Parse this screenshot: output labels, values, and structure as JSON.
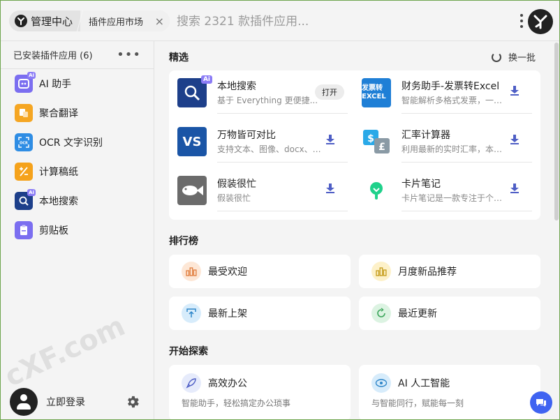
{
  "header": {
    "home_label": "管理中心",
    "current_tab": "插件应用市场",
    "close_symbol": "×",
    "search_placeholder": "搜索 2321 款插件应用..."
  },
  "sidebar": {
    "title": "已安装插件应用 (6)",
    "more": "•••",
    "items": [
      {
        "label": "AI 助手",
        "icon": "ai-assistant-icon",
        "color": "#7b6ef0"
      },
      {
        "label": "聚合翻译",
        "icon": "translate-icon",
        "color": "#f5a623"
      },
      {
        "label": "OCR 文字识别",
        "icon": "ocr-icon",
        "color": "#2f8de4"
      },
      {
        "label": "计算稿纸",
        "icon": "calculator-icon",
        "color": "#f5a21b"
      },
      {
        "label": "本地搜索",
        "icon": "local-search-icon",
        "color": "#1d3f8a"
      },
      {
        "label": "剪贴板",
        "icon": "clipboard-icon",
        "color": "#7b6ef0"
      }
    ],
    "login_label": "立即登录"
  },
  "featured": {
    "title": "精选",
    "refresh_label": "换一批",
    "plugins": [
      {
        "name": "本地搜索",
        "desc": "基于 Everything 更便捷...",
        "action": "打开",
        "icon": "local-search-icon"
      },
      {
        "name": "财务助手-发票转Excel",
        "desc": "智能解析多格式发票，一键...",
        "icon": "invoice-excel-icon",
        "icon_text": "发票转 EXCEL"
      },
      {
        "name": "万物皆可对比",
        "desc": "支持文本、图像、docx、e...",
        "icon": "compare-icon",
        "icon_text": "VS"
      },
      {
        "name": "汇率计算器",
        "desc": "利用最新的实时汇率，本换...",
        "icon": "exchange-rate-icon"
      },
      {
        "name": "假装很忙",
        "desc": "假装很忙",
        "icon": "fish-icon"
      },
      {
        "name": "卡片笔记",
        "desc": "卡片笔记是一款专注于个人...",
        "icon": "card-note-icon"
      }
    ]
  },
  "ranking": {
    "title": "排行榜",
    "items": [
      {
        "label": "最受欢迎",
        "icon": "bar-chart-icon",
        "bg": "#fde7d6"
      },
      {
        "label": "月度新品推荐",
        "icon": "bar-chart-icon",
        "bg": "#fdf1c9"
      },
      {
        "label": "最新上架",
        "icon": "upload-icon",
        "bg": "#d7ecfb"
      },
      {
        "label": "最近更新",
        "icon": "refresh-icon",
        "bg": "#dcf3e2"
      }
    ]
  },
  "explore": {
    "title": "开始探索",
    "items": [
      {
        "title": "高效办公",
        "desc": "智能助手，轻松搞定办公琐事",
        "icon": "rocket-icon"
      },
      {
        "title": "AI 人工智能",
        "desc": "与智能同行，赋能每一刻",
        "icon": "ai-eye-icon"
      }
    ]
  },
  "watermark": "cXF.com"
}
